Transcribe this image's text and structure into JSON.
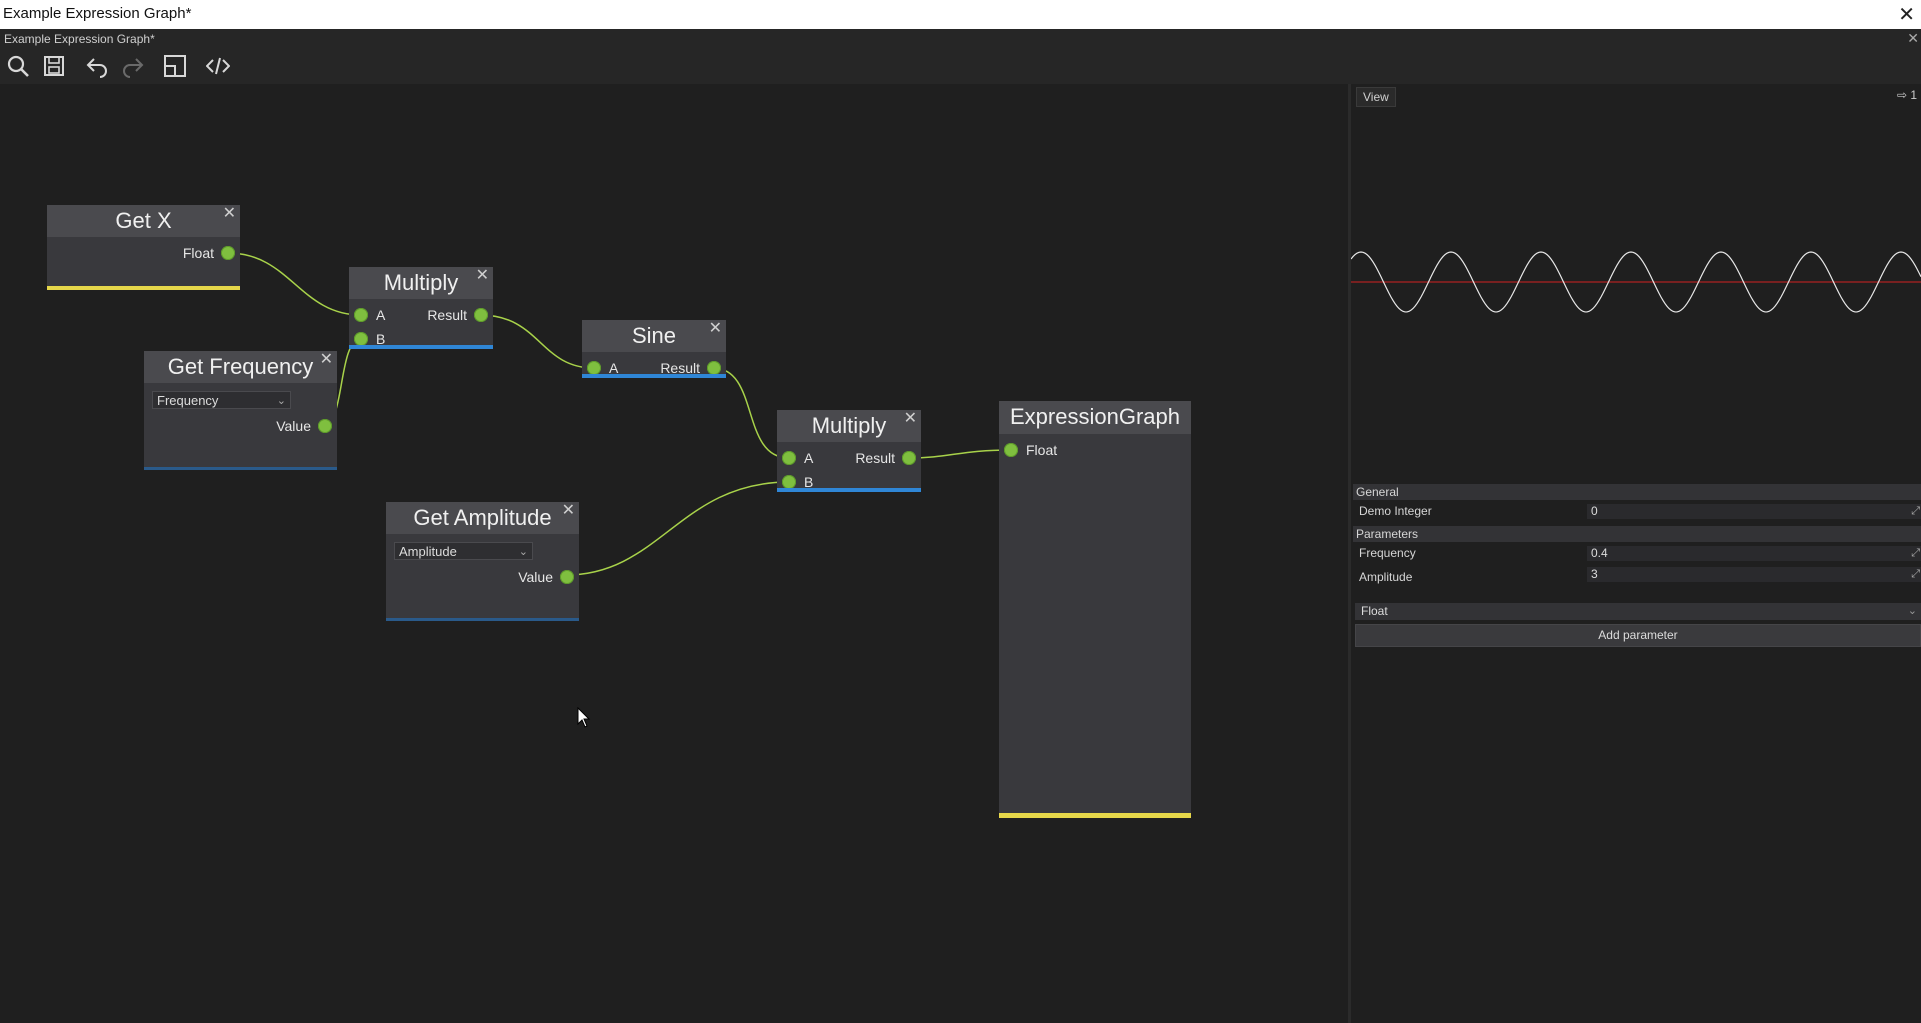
{
  "window": {
    "os_title": "Example Expression Graph*",
    "title": "Example Expression Graph*"
  },
  "toolbar": {
    "items": [
      "search-icon",
      "save-icon",
      "undo-icon",
      "redo-icon",
      "resize-icon",
      "code-icon"
    ]
  },
  "nodes": {
    "get_x": {
      "title": "Get X",
      "out_label": "Float"
    },
    "multiply1": {
      "title": "Multiply",
      "in_a": "A",
      "in_b": "B",
      "out_label": "Result"
    },
    "get_frequency": {
      "title": "Get Frequency",
      "dropdown": "Frequency",
      "out_label": "Value"
    },
    "sine": {
      "title": "Sine",
      "in_a": "A",
      "out_label": "Result"
    },
    "multiply2": {
      "title": "Multiply",
      "in_a": "A",
      "in_b": "B",
      "out_label": "Result"
    },
    "get_amplitude": {
      "title": "Get Amplitude",
      "dropdown": "Amplitude",
      "out_label": "Value"
    },
    "expression_graph": {
      "title": "ExpressionGraph",
      "in_label": "Float"
    }
  },
  "colors": {
    "pin": "#7fbf3f",
    "wire": "#a8d24a",
    "float_bar": "#e6d74a",
    "op_bar": "#2f86d6",
    "param_bar": "#2a5a8a",
    "wave": "#e8e8e8",
    "axis": "#d02020"
  },
  "preview": {
    "tab": "View",
    "right_label": "⇨ 1"
  },
  "general": {
    "header": "General",
    "demo_integer": {
      "label": "Demo Integer",
      "value": "0"
    }
  },
  "parameters": {
    "header": "Parameters",
    "frequency": {
      "label": "Frequency",
      "value": "0.4"
    },
    "amplitude": {
      "label": "Amplitude",
      "value": "3"
    }
  },
  "add_param": {
    "type_select": "Float",
    "button": "Add parameter"
  }
}
